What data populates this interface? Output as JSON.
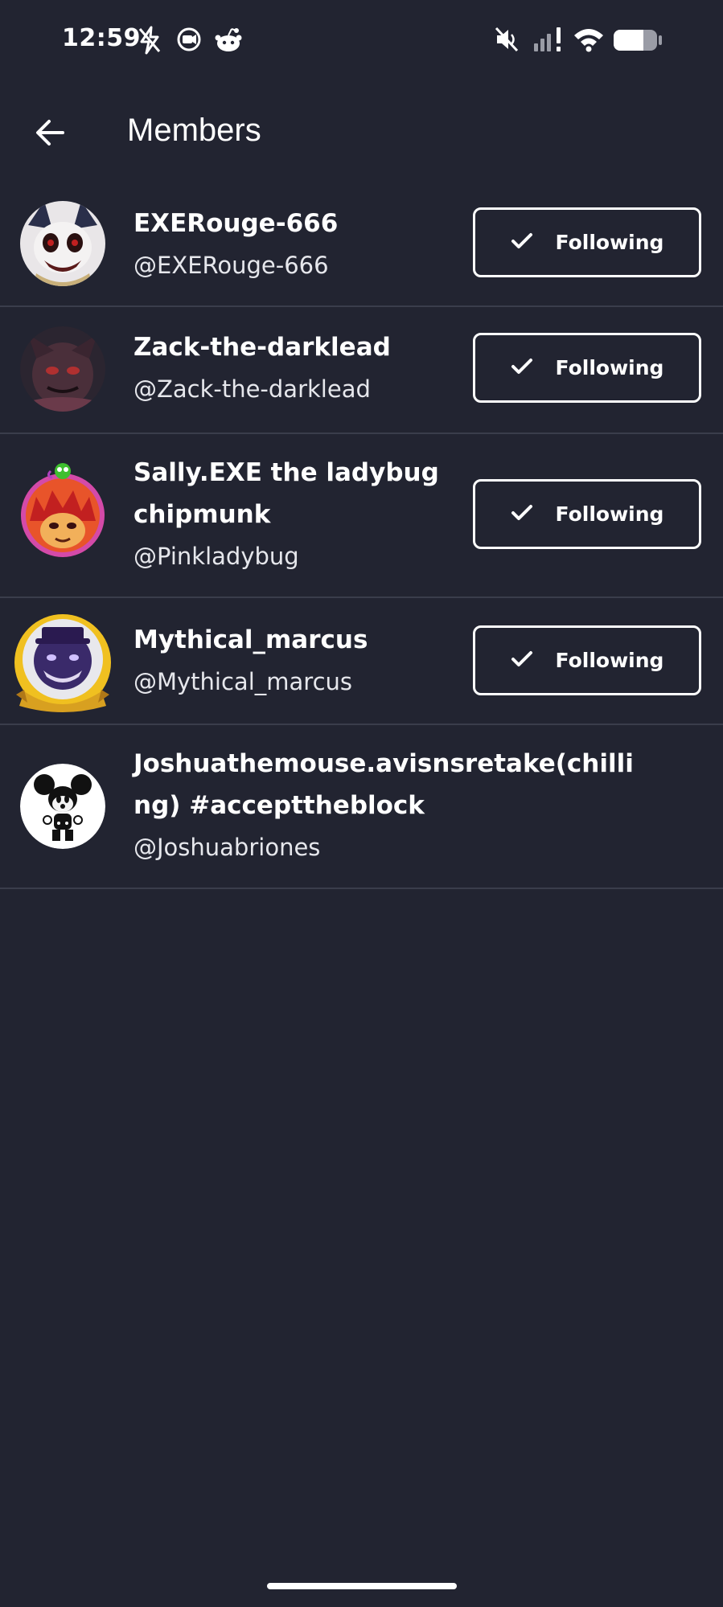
{
  "status_bar": {
    "time": "12:59",
    "left_icons": [
      "lightning-off-icon",
      "screen-record-icon",
      "reddit-icon"
    ],
    "right_icons": [
      "mute-icon",
      "signal-icon",
      "wifi-icon",
      "battery-icon"
    ]
  },
  "header": {
    "title": "Members",
    "back_icon": "arrow-left-icon"
  },
  "members": [
    {
      "display_name": "EXERouge-666",
      "handle": "@EXERouge-666",
      "follow_label": "Following"
    },
    {
      "display_name": "Zack-the-darklead",
      "handle": "@Zack-the-darklead",
      "follow_label": "Following"
    },
    {
      "display_name": "Sally.EXE the ladybug chipmunk",
      "handle": "@Pinkladybug",
      "follow_label": "Following"
    },
    {
      "display_name": "Mythical_marcus",
      "handle": "@Mythical_marcus",
      "follow_label": "Following"
    },
    {
      "display_name": "Joshuathemouse.avisnsretake(chilling) #accepttheblock",
      "handle": "@Joshuabriones"
    }
  ],
  "colors": {
    "background": "#222431",
    "divider": "#3a3d4b",
    "text": "#ffffff"
  }
}
